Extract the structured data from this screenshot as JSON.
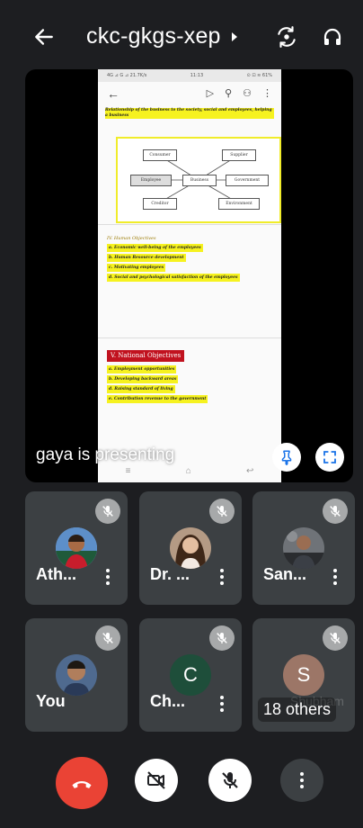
{
  "header": {
    "meeting_code": "ckc-gkgs-xep"
  },
  "presentation": {
    "presenter_text": "gaya is presenting",
    "shared_phone": {
      "status_left": "4G ⊿ G ⊿ 21.7K/s",
      "status_time": "11:13",
      "status_right": "⊙ ⊡ ≋ 61%",
      "doc_intro": "Relationship of the business to the society, social and employees, helping a business",
      "diagram": {
        "nodes": [
          "Consumer",
          "Supplier",
          "Employee",
          "Business",
          "Government",
          "Creditor",
          "Environment"
        ]
      },
      "section_titles": {
        "human": "IV. Human Objectives",
        "national": "V. National Objectives"
      },
      "human_objectives": [
        "a. Economic well-being of the employees",
        "b. Human Resource development",
        "c. Motivating employees",
        "d. Social and psychological satisfaction of the employees"
      ],
      "national_objectives": [
        "a. Employment opportunities",
        "b. Developing backward areas",
        "d. Raising standard of living",
        "e. Contribution revenue to the government"
      ]
    }
  },
  "participants": [
    {
      "name": "Ath...",
      "avatar": "photo",
      "muted": true
    },
    {
      "name": "Dr. ...",
      "avatar": "photo",
      "muted": true
    },
    {
      "name": "San...",
      "avatar": "photo",
      "muted": true
    },
    {
      "name": "You",
      "avatar": "photo",
      "muted": true
    },
    {
      "name": "Ch...",
      "avatar_letter": "C",
      "avatar_color": "#1e4e3a",
      "muted": true
    },
    {
      "avatar_letter": "S",
      "avatar_color": "#9c7667",
      "ghost_name": "Shubham",
      "others_label": "18 others",
      "muted": true
    }
  ],
  "colors": {
    "end_call": "#ea4335",
    "tile_bg": "#3c4043",
    "background": "#1d1e21",
    "highlight": "#f6f21f"
  },
  "icons": {
    "back": "arrow-left-icon",
    "switch_camera": "switch-camera-icon",
    "audio_output": "headphones-icon",
    "pin": "pin-icon",
    "fullscreen": "fullscreen-icon",
    "mic_off": "mic-off-icon",
    "cam_off": "camera-off-icon",
    "end_call": "phone-end-icon",
    "more": "more-vertical-icon"
  }
}
